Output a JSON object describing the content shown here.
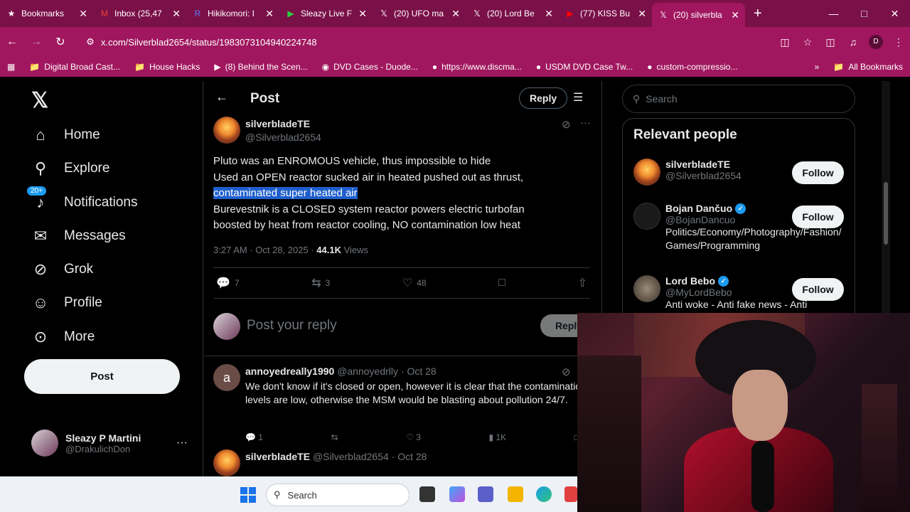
{
  "browser": {
    "tabs": [
      {
        "title": "Bookmarks",
        "icon": "star-icon",
        "color": "#ffffff"
      },
      {
        "title": "Inbox (25,47",
        "icon": "gmail-icon",
        "color": "#ea4335"
      },
      {
        "title": "Hikikomori: I",
        "icon": "r-icon",
        "color": "#5b7cfa"
      },
      {
        "title": "Sleazy Live F",
        "icon": "play-icon",
        "color": "#2ecc40"
      },
      {
        "title": "(20) UFO ma",
        "icon": "x-icon",
        "color": "#ffffff"
      },
      {
        "title": "(20) Lord Be",
        "icon": "x-icon",
        "color": "#ffffff"
      },
      {
        "title": "(77) KISS Bu",
        "icon": "youtube-icon",
        "color": "#ff0000"
      },
      {
        "title": "(20) silverbla",
        "icon": "x-icon",
        "color": "#ffffff"
      }
    ],
    "url": "x.com/Silverblad2654/status/1983073104940224748",
    "profile_initial": "D",
    "bookmarks": [
      {
        "label": "Digital Broad Cast...",
        "icon": "folder-icon"
      },
      {
        "label": "House Hacks",
        "icon": "folder-icon"
      },
      {
        "label": "(8) Behind the Scen...",
        "icon": "youtube-icon"
      },
      {
        "label": "DVD Cases - Duode...",
        "icon": "disc-icon"
      },
      {
        "label": "https://www.discma...",
        "icon": "site-icon"
      },
      {
        "label": "USDM DVD Case Tw...",
        "icon": "site-icon"
      },
      {
        "label": "custom-compressio...",
        "icon": "site-icon"
      }
    ],
    "all_bookmarks": "All Bookmarks"
  },
  "nav": {
    "items": [
      {
        "label": "Home",
        "icon": "home-icon"
      },
      {
        "label": "Explore",
        "icon": "search-icon"
      },
      {
        "label": "Notifications",
        "icon": "bell-icon",
        "badge": "20+"
      },
      {
        "label": "Messages",
        "icon": "mail-icon"
      },
      {
        "label": "Grok",
        "icon": "grok-icon"
      },
      {
        "label": "Profile",
        "icon": "person-icon"
      },
      {
        "label": "More",
        "icon": "more-circle-icon"
      }
    ],
    "post_label": "Post",
    "account": {
      "name": "Sleazy P Martini",
      "handle": "@DrakulichDon"
    }
  },
  "main": {
    "header_title": "Post",
    "reply_pill": "Reply",
    "post": {
      "name": "silverbladeTE",
      "handle": "@Silverblad2654",
      "lines": [
        "Pluto was an ENROMOUS vehicle, thus impossible to hide",
        "Used an OPEN reactor sucked air in heated pushed out as thrust,",
        "contaminated super heated air",
        " Burevestnik is a CLOSED system reactor powers electric turbofan",
        "boosted by heat from reactor cooling, NO contamination low heat"
      ],
      "time": "3:27 AM · Oct 28, 2025 ·",
      "views_count": "44.1K",
      "views_label": "Views",
      "replies": "7",
      "reposts": "3",
      "likes": "48"
    },
    "reply_placeholder": "Post your reply",
    "reply_button": "Reply",
    "comments": [
      {
        "avatar_letter": "a",
        "name": "annoyedreally1990",
        "handle": "@annoyedrlly · Oct 28",
        "text": "We don't know if it's closed or open, however it is clear that the contamination levels are low, otherwise the MSM would be blasting about pollution 24/7.",
        "replies": "1",
        "reposts": "",
        "likes": "3",
        "views": "1K"
      },
      {
        "name": "silverbladeTE",
        "handle": "@Silverblad2654 · Oct 28"
      }
    ]
  },
  "sidebar": {
    "search_placeholder": "Search",
    "relevant_title": "Relevant people",
    "people": [
      {
        "name": "silverbladeTE",
        "handle": "@Silverblad2654",
        "bio": "",
        "follow": "Follow",
        "verified": false
      },
      {
        "name": "Bojan Dančuo",
        "handle": "@BojanDancuo",
        "bio": "Politics/Economy/Photography/Fashion/Games/Programming",
        "follow": "Follow",
        "verified": true
      },
      {
        "name": "Lord Bebo",
        "handle": "@MyLordBebo",
        "bio": "Anti woke - Anti fake news - Anti",
        "follow": "Follow",
        "verified": true
      }
    ]
  },
  "taskbar": {
    "search_label": "Search"
  }
}
